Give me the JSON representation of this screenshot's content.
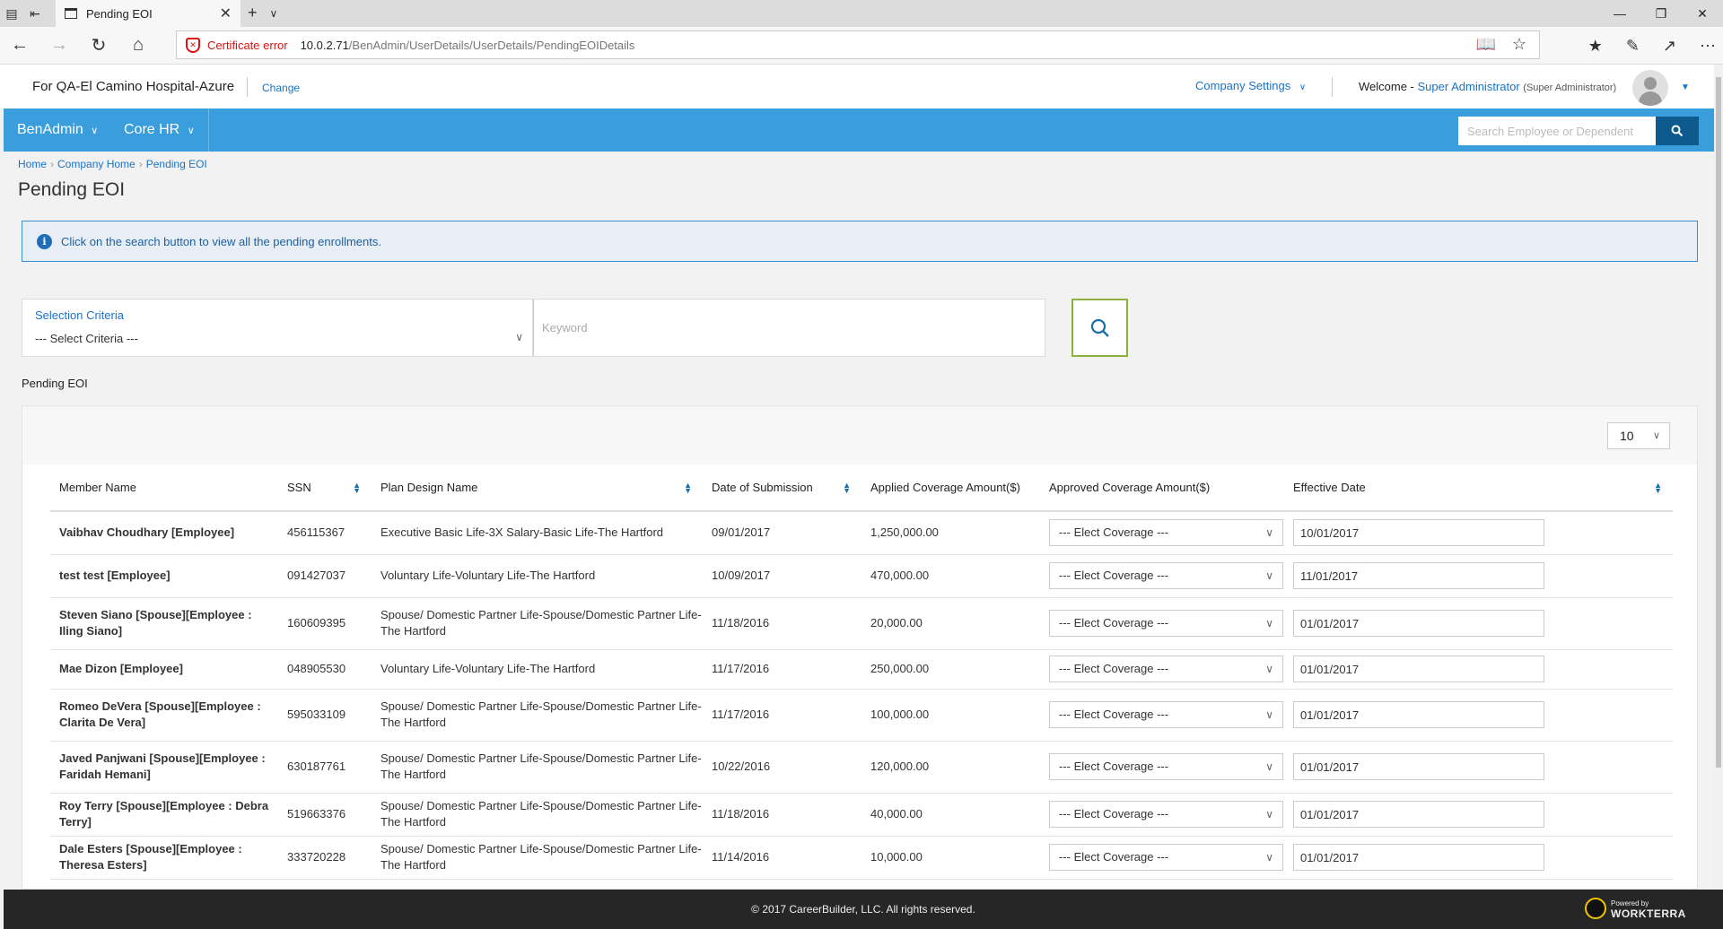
{
  "browser": {
    "tab_title": "Pending EOI",
    "cert_error": "Certificate error",
    "url_host": "10.0.2.71",
    "url_path": "/BenAdmin/UserDetails/UserDetails/PendingEOIDetails"
  },
  "header": {
    "company": "For QA-El Camino Hospital-Azure",
    "change": "Change",
    "company_settings": "Company Settings",
    "welcome": "Welcome - ",
    "user": "Super Administrator",
    "role": "(Super Administrator)"
  },
  "nav": {
    "menus": [
      "BenAdmin",
      "Core HR"
    ],
    "search_placeholder": "Search Employee or Dependent"
  },
  "breadcrumb": [
    "Home",
    "Company Home",
    "Pending EOI"
  ],
  "page_title": "Pending EOI",
  "info_message": "Click on the search button to view all the pending enrollments.",
  "search": {
    "criteria_label": "Selection Criteria",
    "criteria_value": "--- Select Criteria ---",
    "keyword_placeholder": "Keyword"
  },
  "section_label": "Pending EOI",
  "page_size": "10",
  "table": {
    "columns": [
      "Member Name",
      "SSN",
      "Plan Design Name",
      "Date of Submission",
      "Applied Coverage Amount($)",
      "Approved Coverage Amount($)",
      "Effective Date"
    ],
    "rows": [
      {
        "name": "Vaibhav Choudhary [Employee]",
        "ssn": "456115367",
        "plan": "Executive Basic Life-3X Salary-Basic Life-The Hartford",
        "date": "09/01/2017",
        "applied": "1,250,000.00",
        "approved": "--- Elect Coverage ---",
        "effective": "10/01/2017"
      },
      {
        "name": "test test [Employee]",
        "ssn": "091427037",
        "plan": "Voluntary Life-Voluntary Life-The Hartford",
        "date": "10/09/2017",
        "applied": "470,000.00",
        "approved": "--- Elect Coverage ---",
        "effective": "11/01/2017"
      },
      {
        "name": "Steven Siano [Spouse][Employee : Iling Siano]",
        "ssn": "160609395",
        "plan": "Spouse/ Domestic Partner Life-Spouse/Domestic Partner Life-The Hartford",
        "date": "11/18/2016",
        "applied": "20,000.00",
        "approved": "--- Elect Coverage ---",
        "effective": "01/01/2017"
      },
      {
        "name": "Mae Dizon [Employee]",
        "ssn": "048905530",
        "plan": "Voluntary Life-Voluntary Life-The Hartford",
        "date": "11/17/2016",
        "applied": "250,000.00",
        "approved": "--- Elect Coverage ---",
        "effective": "01/01/2017"
      },
      {
        "name": "Romeo DeVera [Spouse][Employee : Clarita De Vera]",
        "ssn": "595033109",
        "plan": "Spouse/ Domestic Partner Life-Spouse/Domestic Partner Life-The Hartford",
        "date": "11/17/2016",
        "applied": "100,000.00",
        "approved": "--- Elect Coverage ---",
        "effective": "01/01/2017"
      },
      {
        "name": "Javed Panjwani [Spouse][Employee : Faridah Hemani]",
        "ssn": "630187761",
        "plan": "Spouse/ Domestic Partner Life-Spouse/Domestic Partner Life-The Hartford",
        "date": "10/22/2016",
        "applied": "120,000.00",
        "approved": "--- Elect Coverage ---",
        "effective": "01/01/2017"
      },
      {
        "name": "Roy Terry [Spouse][Employee : Debra Terry]",
        "ssn": "519663376",
        "plan": "Spouse/ Domestic Partner Life-Spouse/Domestic Partner Life-The Hartford",
        "date": "11/18/2016",
        "applied": "40,000.00",
        "approved": "--- Elect Coverage ---",
        "effective": "01/01/2017"
      },
      {
        "name": "Dale Esters [Spouse][Employee : Theresa Esters]",
        "ssn": "333720228",
        "plan": "Spouse/ Domestic Partner Life-Spouse/Domestic Partner Life-The Hartford",
        "date": "11/14/2016",
        "applied": "10,000.00",
        "approved": "--- Elect Coverage ---",
        "effective": "01/01/2017"
      }
    ]
  },
  "footer": {
    "copyright": "© 2017 CareerBuilder, LLC. All rights reserved.",
    "powered_by": "Powered by",
    "brand": "WORKTERRA"
  },
  "colors": {
    "nav_blue": "#3a9ddc",
    "link_blue": "#1a73c5",
    "search_border_green": "#8cb13e",
    "footer_dark": "#262626"
  }
}
